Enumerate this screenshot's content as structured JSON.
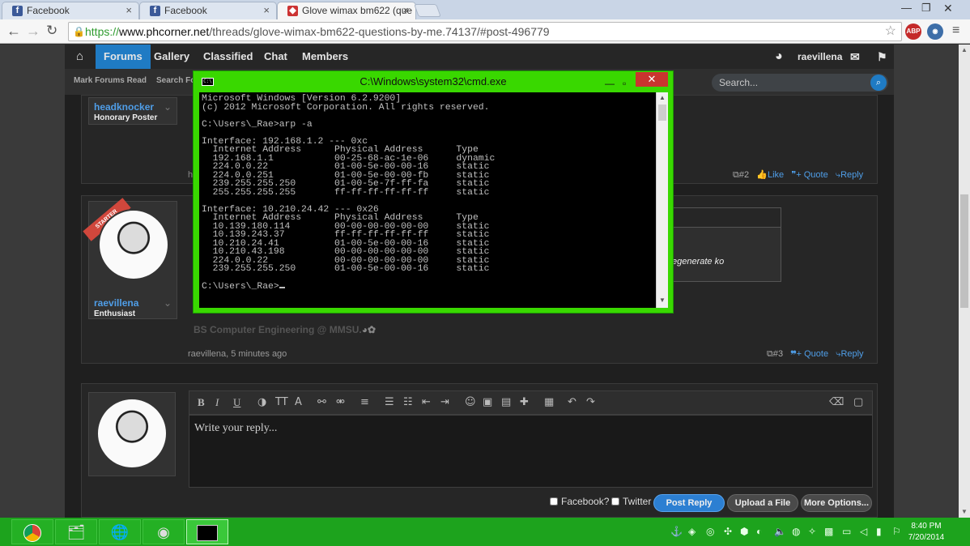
{
  "browser": {
    "tabs": [
      {
        "label": "Facebook",
        "icon": "facebook-icon"
      },
      {
        "label": "Facebook",
        "icon": "facebook-icon"
      },
      {
        "label": "Glove wimax bm622 (que",
        "icon": "phcorner-icon"
      }
    ],
    "url_scheme": "https://",
    "url_host": "www.phcorner.net",
    "url_path": "/threads/glove-wimax-bm622-questions-by-me.74137/#post-496779",
    "ext_abp": "ABP"
  },
  "site": {
    "nav": [
      "Forums",
      "Gallery",
      "Classified",
      "Chat",
      "Members"
    ],
    "user": "raevillena",
    "subnav": [
      "Mark Forums Read",
      "Search Fo"
    ],
    "search_placeholder": "Search..."
  },
  "posts": {
    "first": {
      "username": "headknocker",
      "user_title": "Honorary Poster",
      "leading_char": "h",
      "number": "#2",
      "like": "Like",
      "quote": "+ Quote",
      "reply": "Reply"
    },
    "second": {
      "badge": "STARTER",
      "username": "raevillena",
      "user_title": "Enthusiast",
      "fragment": "egenerate ko",
      "signature": "BS Computer Engineering @ MMSU.",
      "meta": "raevillena, 5 minutes ago",
      "number": "#3",
      "quote": "+ Quote",
      "reply": "Reply"
    }
  },
  "editor": {
    "placeholder": "Write your reply...",
    "facebook": "Facebook?",
    "twitter": "Twitter",
    "post_reply": "Post Reply",
    "upload": "Upload a File",
    "more": "More Options..."
  },
  "cmd": {
    "title": "C:\\Windows\\system32\\cmd.exe",
    "lines": [
      "Microsoft Windows [Version 6.2.9200]",
      "(c) 2012 Microsoft Corporation. All rights reserved.",
      "",
      "C:\\Users\\_Rae>arp -a",
      "",
      "Interface: 192.168.1.2 --- 0xc",
      "  Internet Address      Physical Address      Type",
      "  192.168.1.1           00-25-68-ac-1e-06     dynamic",
      "  224.0.0.22            01-00-5e-00-00-16     static",
      "  224.0.0.251           01-00-5e-00-00-fb     static",
      "  239.255.255.250       01-00-5e-7f-ff-fa     static",
      "  255.255.255.255       ff-ff-ff-ff-ff-ff     static",
      "",
      "Interface: 10.210.24.42 --- 0x26",
      "  Internet Address      Physical Address      Type",
      "  10.139.180.114        00-00-00-00-00-00     static",
      "  10.139.243.37         ff-ff-ff-ff-ff-ff     static",
      "  10.210.24.41          01-00-5e-00-00-16     static",
      "  10.210.43.198         00-00-00-00-00-00     static",
      "  224.0.0.22            00-00-00-00-00-00     static",
      "  239.255.255.250       01-00-5e-00-00-16     static",
      ""
    ],
    "prompt": "C:\\Users\\_Rae>"
  },
  "taskbar": {
    "time": "8:40 PM",
    "date": "7/20/2014"
  },
  "colors": {
    "accent": "#1f7bc4",
    "cmd_frame": "#39d800",
    "taskbar": "#1da31d"
  }
}
